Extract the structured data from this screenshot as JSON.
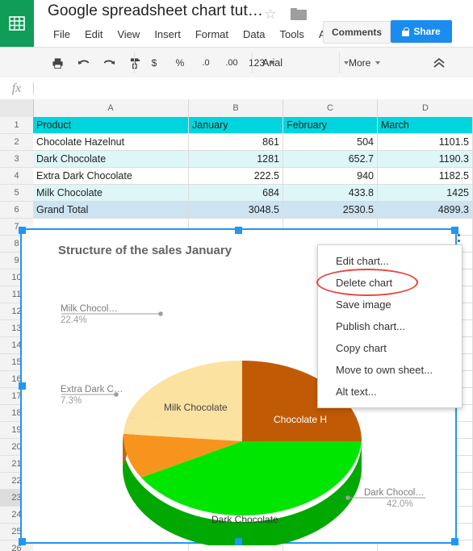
{
  "header": {
    "logo_icon": "sheets-grid-icon",
    "doc_title": "Google spreadsheet chart tut…",
    "star_icon": "star-outline-icon",
    "star_glyph": "☆",
    "folder_icon": "folder-icon",
    "menu_items": [
      "File",
      "Edit",
      "View",
      "Insert",
      "Format",
      "Data",
      "Tools",
      "Add-"
    ],
    "comments_label": "Comments",
    "share_label": "Share",
    "share_icon": "lock-icon",
    "share_color": "#1a8cf0",
    "logo_color": "#0f9d58"
  },
  "toolbar": {
    "print_icon": "print-icon",
    "undo_icon": "undo-arrow-icon",
    "redo_icon": "redo-arrow-icon",
    "paint_icon": "paint-format-icon",
    "currency_label": "$",
    "percent_label": "%",
    "dec_decrease_label": ".0",
    "dec_increase_label": ".00",
    "format_label": "123",
    "font_name": "Arial",
    "more_label": "More",
    "collapse_icon": "chevron-double-up-icon"
  },
  "formula_bar": {
    "fx_label": "fx",
    "value": "",
    "placeholder": ""
  },
  "sheet": {
    "columns": [
      "A",
      "B",
      "C",
      "D"
    ],
    "row_numbers": [
      "1",
      "2",
      "3",
      "4",
      "5",
      "6",
      "7",
      "8",
      "9",
      "10",
      "11",
      "12",
      "13",
      "14",
      "15",
      "16",
      "17",
      "18",
      "19",
      "20",
      "21",
      "22",
      "23",
      "24",
      "25",
      "26"
    ],
    "selected_row": "23",
    "header_color": "#00d5dd",
    "band_color": "#dff6f8",
    "total_color": "#cde3f2",
    "rows": [
      {
        "cells": [
          "Product",
          "January",
          "February",
          "March"
        ],
        "style": "header"
      },
      {
        "cells": [
          "Chocolate Hazelnut",
          "861",
          "504",
          "1101.5"
        ],
        "style": "plain"
      },
      {
        "cells": [
          "Dark Chocolate",
          "1281",
          "652.7",
          "1190.3"
        ],
        "style": "band"
      },
      {
        "cells": [
          "Extra Dark Chocolate",
          "222.5",
          "940",
          "1182.5"
        ],
        "style": "plain"
      },
      {
        "cells": [
          "Milk Chocolate",
          "684",
          "433.8",
          "1425"
        ],
        "style": "band"
      },
      {
        "cells": [
          "Grand Total",
          "3048.5",
          "2530.5",
          "4899.3"
        ],
        "style": "total"
      }
    ]
  },
  "chart_data": {
    "type": "pie",
    "title": "Structure of the sales January",
    "xlabel": "",
    "ylabel": "",
    "legend_position": "none",
    "labels": [
      "Chocolate Hazelnut",
      "Dark Chocolate",
      "Extra Dark Chocolate",
      "Milk Chocolate"
    ],
    "values": [
      861,
      1281,
      222.5,
      684
    ],
    "percentages": [
      "28.2%",
      "42.0%",
      "7.3%",
      "22.4%"
    ],
    "colors": [
      "#c15a05",
      "#00e600",
      "#f7941e",
      "#fbe2a0"
    ],
    "side_colors": [
      "#8f4204",
      "#00a800",
      "#b86c14",
      "#d9bd79"
    ],
    "callouts": [
      {
        "name": "Milk Chocol…",
        "pct": "22.4%"
      },
      {
        "name": "Extra Dark C…",
        "pct": "7.3%"
      },
      {
        "name": "Dark Chocol…",
        "pct": "42.0%"
      }
    ],
    "inner_labels": [
      {
        "text": "Milk Chocolate",
        "color": "#444444"
      },
      {
        "text": "Chocolate H",
        "color": "#ffffff"
      },
      {
        "text": "Dark Chocolate",
        "color": "#333333"
      }
    ]
  },
  "context_menu": {
    "items": [
      "Edit chart...",
      "Delete chart",
      "Save image",
      "Publish chart...",
      "Copy chart",
      "Move to own sheet...",
      "Alt text..."
    ],
    "menu_icon": "three-dots-vertical-icon",
    "highlight_item": "Delete chart",
    "highlight_color": "#e8453c"
  }
}
